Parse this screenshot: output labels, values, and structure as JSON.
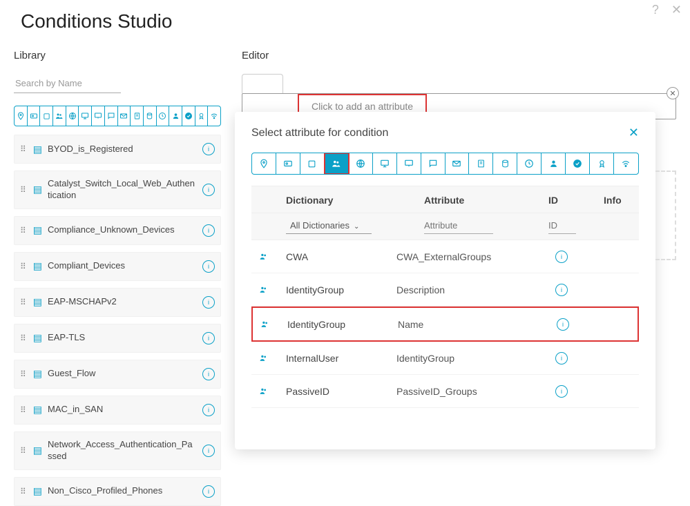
{
  "title": "Conditions Studio",
  "sections": {
    "library": "Library",
    "editor": "Editor"
  },
  "search_placeholder": "Search by Name",
  "conditions": [
    "BYOD_is_Registered",
    "Catalyst_Switch_Local_Web_Authentication",
    "Compliance_Unknown_Devices",
    "Compliant_Devices",
    "EAP-MSCHAPv2",
    "EAP-TLS",
    "Guest_Flow",
    "MAC_in_SAN",
    "Network_Access_Authentication_Passed",
    "Non_Cisco_Profiled_Phones"
  ],
  "editor": {
    "placeholder": "Click to add an attribute"
  },
  "popover": {
    "title": "Select attribute for condition",
    "headers": {
      "dictionary": "Dictionary",
      "attribute": "Attribute",
      "id": "ID",
      "info": "Info"
    },
    "filters": {
      "dictionaries": "All Dictionaries",
      "attribute": "Attribute",
      "id": "ID"
    },
    "rows": [
      {
        "dictionary": "CWA",
        "attribute": "CWA_ExternalGroups",
        "highlight": false
      },
      {
        "dictionary": "IdentityGroup",
        "attribute": "Description",
        "highlight": false
      },
      {
        "dictionary": "IdentityGroup",
        "attribute": "Name",
        "highlight": true
      },
      {
        "dictionary": "InternalUser",
        "attribute": "IdentityGroup",
        "highlight": false
      },
      {
        "dictionary": "PassiveID",
        "attribute": "PassiveID_Groups",
        "highlight": false
      }
    ]
  },
  "lib_toolbar_icons": [
    "pin",
    "badge",
    "square",
    "group",
    "globe",
    "monitor",
    "screen",
    "chat",
    "mail",
    "doc",
    "db",
    "clock",
    "user",
    "check",
    "cert",
    "wifi"
  ],
  "pop_toolbar_icons": [
    "pin",
    "badge",
    "square",
    "group",
    "globe",
    "monitor",
    "screen",
    "chat",
    "mail",
    "doc",
    "db",
    "clock",
    "user",
    "check",
    "cert",
    "wifi"
  ]
}
